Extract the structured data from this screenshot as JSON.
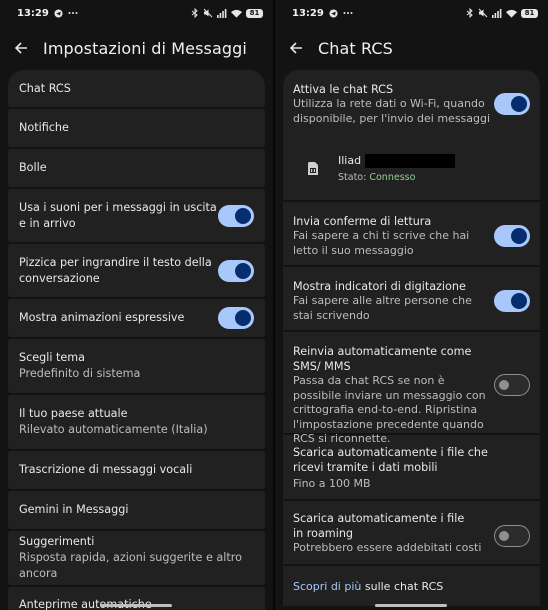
{
  "left": {
    "status": {
      "time": "13:29",
      "battery": "81"
    },
    "title": "Impostazioni di Messaggi",
    "items": [
      {
        "label": "Chat RCS"
      },
      {
        "label": "Notifiche"
      },
      {
        "label": "Bolle"
      },
      {
        "label": "Usa i suoni per i messaggi in uscita e in arrivo",
        "toggle": true
      },
      {
        "label": "Pizzica per ingrandire il testo della conversazione",
        "toggle": true
      },
      {
        "label": "Mostra animazioni espressive",
        "toggle": true
      },
      {
        "label": "Scegli tema",
        "sub": "Predefinito di sistema"
      },
      {
        "label": "Il tuo paese attuale",
        "sub": "Rilevato automaticamente (Italia)"
      },
      {
        "label": "Trascrizione di messaggi vocali"
      },
      {
        "label": "Gemini in Messaggi"
      },
      {
        "label": "Suggerimenti",
        "sub": "Risposta rapida, azioni suggerite e altro ancora"
      },
      {
        "label": "Anteprime automatiche"
      }
    ]
  },
  "right": {
    "status": {
      "time": "13:29",
      "battery": "81"
    },
    "title": "Chat RCS",
    "enable": {
      "title": "Attiva le chat RCS",
      "desc": "Utilizza la rete dati o Wi-Fi, quando disponibile, per l'invio dei messaggi",
      "toggle": true
    },
    "sim": {
      "name": "Iliad",
      "status_label": "Stato:",
      "status_value": "Connesso"
    },
    "read_receipts": {
      "title": "Invia conferme di lettura",
      "desc": "Fai sapere a chi ti scrive che hai letto il suo messaggio",
      "toggle": true
    },
    "typing": {
      "title": "Mostra indicatori di digitazione",
      "desc": "Fai sapere alle altre persone che stai scrivendo",
      "toggle": true
    },
    "resend": {
      "title": "Reinvia automaticamente come SMS/ MMS",
      "desc": "Passa da chat RCS se non è possibile inviare un messaggio con crittografia end-to-end. Ripristina l'impostazione precedente quando RCS si riconnette.",
      "toggle": false
    },
    "download_mobile": {
      "title": "Scarica automaticamente i file che ricevi tramite i dati mobili",
      "desc": "Fino a 100 MB"
    },
    "download_roaming": {
      "title": "Scarica automaticamente i file in roaming",
      "desc": "Potrebbero essere addebitati costi",
      "toggle": false
    },
    "learn_more": {
      "link": "Scopri di più",
      "rest": " sulle chat RCS"
    }
  },
  "colors": {
    "toggle_on": "#a8c7fa",
    "knob_on": "#062e6f",
    "card": "#212121",
    "connected": "#8ecf8e"
  }
}
